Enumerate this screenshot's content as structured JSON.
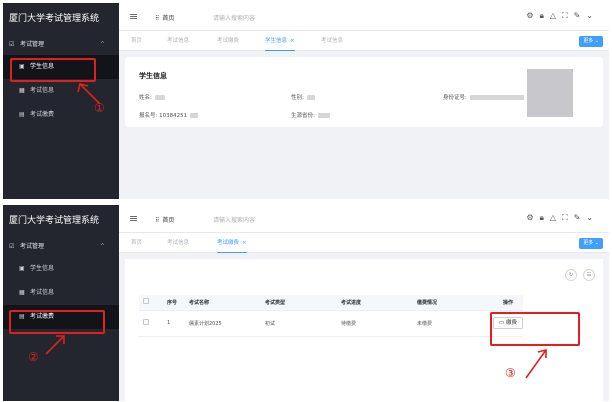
{
  "app_title": "厦门大学考试管理系统",
  "sidebar": {
    "group_label": "考试管理",
    "items": {
      "student_info": "学生信息",
      "exam_info": "考试信息",
      "exam_fee": "考试缴费"
    }
  },
  "topbar": {
    "home_label_1": "首页",
    "home_label_2": "首页",
    "search_placeholder": "请输入搜索内容"
  },
  "tabs1": [
    "首页",
    "考试信息",
    "考试缴费",
    "学生信息",
    "考试信息"
  ],
  "tabs2": [
    "首页",
    "考试信息",
    "考试缴费"
  ],
  "more_button": "更多",
  "student_card": {
    "title": "学生信息",
    "name_label": "姓名:",
    "gender_label": "性别:",
    "id_label": "身份证号:",
    "reg_label": "报名号:",
    "reg_value": "10384251",
    "origin_label": "生源省份:"
  },
  "fee_table": {
    "columns": [
      "序号",
      "考试名称",
      "考试类型",
      "考试进度",
      "缴费情况",
      "操作"
    ],
    "rows": [
      {
        "index": "1",
        "exam_name": "儒素计划2025",
        "exam_type": "初试",
        "progress": "待缴费",
        "payment": "未缴费",
        "action": "缴费"
      }
    ]
  },
  "annotations": [
    "①",
    "②",
    "③"
  ],
  "colors": {
    "accent": "#409eff",
    "sidebar_bg": "#23262e",
    "highlight": "#e02020"
  }
}
